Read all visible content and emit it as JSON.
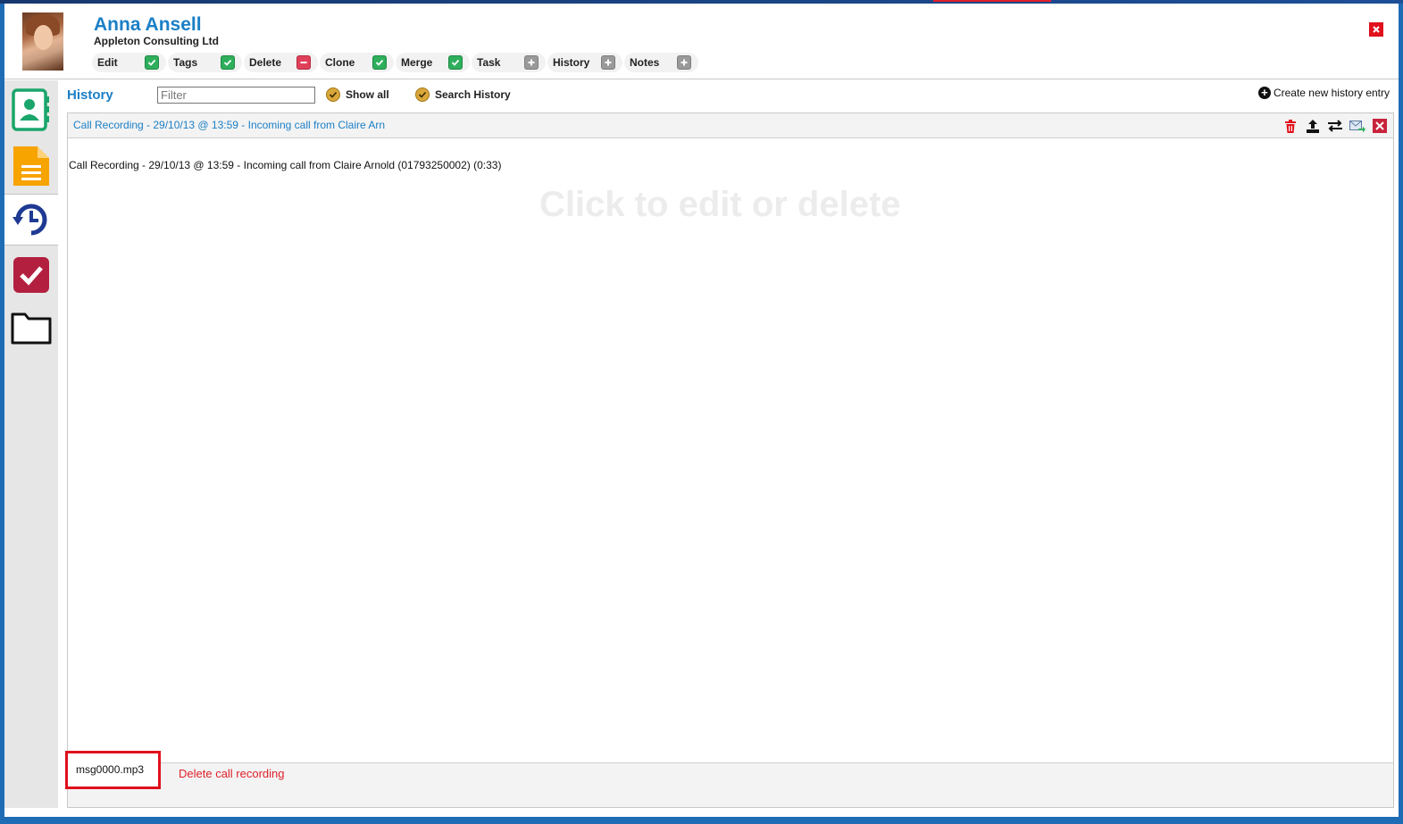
{
  "contact": {
    "name": "Anna Ansell",
    "company": "Appleton Consulting Ltd"
  },
  "actions": [
    {
      "label": "Edit",
      "icon": "check-icon"
    },
    {
      "label": "Tags",
      "icon": "check-icon"
    },
    {
      "label": "Delete",
      "icon": "minus-icon"
    },
    {
      "label": "Clone",
      "icon": "check-icon"
    },
    {
      "label": "Merge",
      "icon": "check-icon"
    },
    {
      "label": "Task",
      "icon": "plus-icon"
    },
    {
      "label": "History",
      "icon": "plus-icon"
    },
    {
      "label": "Notes",
      "icon": "plus-icon"
    }
  ],
  "nav": [
    {
      "name": "contact-card-icon",
      "active": false
    },
    {
      "name": "document-icon",
      "active": false
    },
    {
      "name": "history-icon",
      "active": true
    },
    {
      "name": "task-check-icon",
      "active": false
    },
    {
      "name": "folder-icon",
      "active": false
    }
  ],
  "history": {
    "title": "History",
    "filter_placeholder": "Filter",
    "show_all_label": "Show all",
    "search_history_label": "Search History",
    "create_new_label": "Create new history entry"
  },
  "entry": {
    "header": "Call Recording - 29/10/13 @ 13:59 - Incoming call from Claire Arn",
    "body": "Call Recording - 29/10/13 @ 13:59 - Incoming call from Claire Arnold (01793250002) (0:33)",
    "watermark": "Click to edit or delete",
    "recording_file": "msg0000.mp3",
    "delete_recording_label": "Delete call recording"
  },
  "colors": {
    "accent_blue": "#1b7fc6",
    "danger_red": "#e0101c",
    "check_green": "#2fae5c",
    "frame_blue": "#1d6cb5"
  }
}
